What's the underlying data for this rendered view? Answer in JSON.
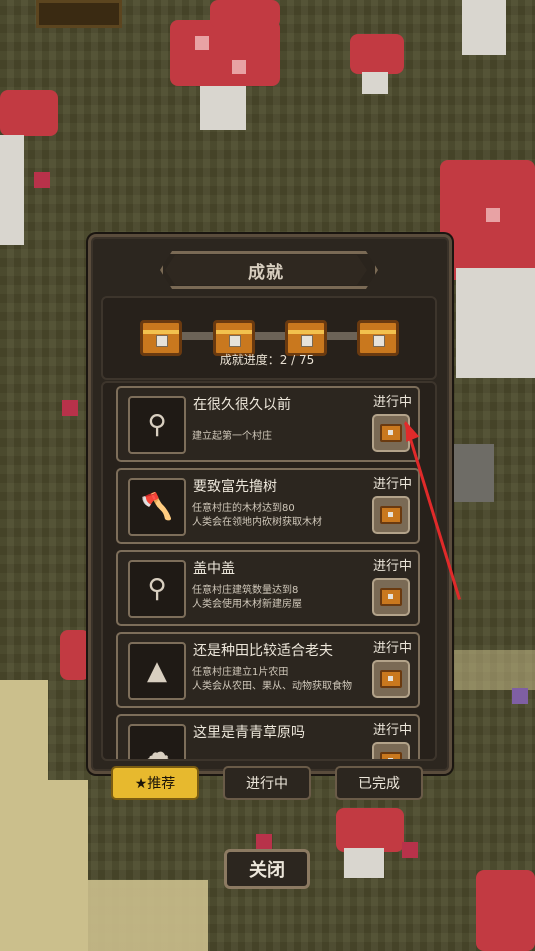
{
  "dialog": {
    "title": "成就",
    "progress_label": "成就进度：2 / 75",
    "progress_done": 2,
    "progress_total": 75
  },
  "achievements": [
    {
      "title": "在很久很久以前",
      "desc": [
        "建立起第一个村庄"
      ],
      "status": "进行中",
      "icon": "magnifier-icon"
    },
    {
      "title": "要致富先撸树",
      "desc": [
        "任意村庄的木材达到80",
        "人类会在领地内砍树获取木材"
      ],
      "status": "进行中",
      "icon": "axe-icon"
    },
    {
      "title": "盖中盖",
      "desc": [
        "任意村庄建筑数量达到8",
        "人类会使用木材新建房屋"
      ],
      "status": "进行中",
      "icon": "magnifier-icon"
    },
    {
      "title": "还是种田比较适合老夫",
      "desc": [
        "任意村庄建立1片农田",
        "人类会从农田、果从、动物获取食物"
      ],
      "status": "进行中",
      "icon": "farm-icon"
    },
    {
      "title": "这里是青青草原吗",
      "desc": [],
      "status": "进行中",
      "icon": "sheep-icon"
    }
  ],
  "tabs": [
    "★推荐",
    "进行中",
    "已完成"
  ],
  "active_tab": 0,
  "close_label": "关闭",
  "colors": {
    "accent": "#e7b92e",
    "panel": "#2c261f",
    "border": "#7d6e5a",
    "arrow": "#e02a2a"
  }
}
